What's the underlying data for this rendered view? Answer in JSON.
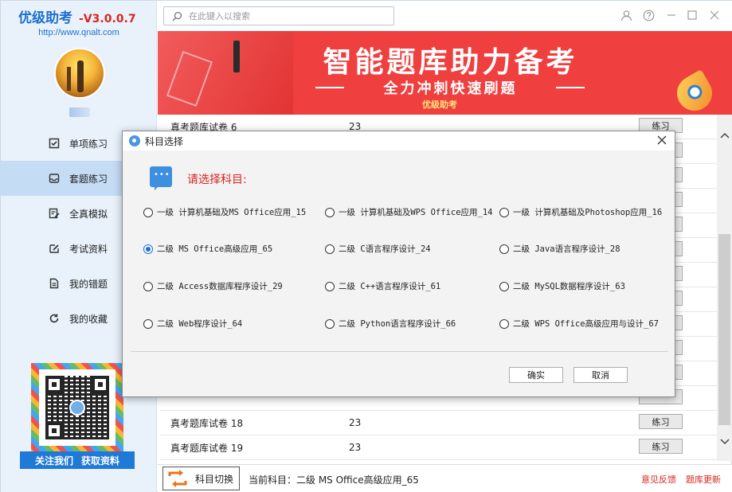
{
  "app": {
    "name": "优级助考",
    "version": "-V3.0.0.7",
    "url": "http://www.qnalt.com"
  },
  "sidebar": {
    "items": [
      {
        "label": "单项练习",
        "icon": "checkbox-icon"
      },
      {
        "label": "套题练习",
        "icon": "inbox-icon"
      },
      {
        "label": "全真模拟",
        "icon": "edit-doc-icon"
      },
      {
        "label": "考试资料",
        "icon": "pencil-note-icon"
      },
      {
        "label": "我的错题",
        "icon": "document-icon"
      },
      {
        "label": "我的收藏",
        "icon": "refresh-icon"
      }
    ],
    "active_index": 1,
    "qr_banner": [
      "关注我们",
      "获取资料"
    ]
  },
  "search": {
    "placeholder": "在此键入以搜索"
  },
  "banner": {
    "headline": "智能题库助力备考",
    "sub": "全力冲刺快速刷题",
    "tag": "优级助考"
  },
  "table": {
    "rows": [
      {
        "name": "真考题库试卷 6",
        "count": "23",
        "action": "练习"
      },
      {
        "name": "",
        "count": "",
        "action": ""
      },
      {
        "name": "",
        "count": "",
        "action": ""
      },
      {
        "name": "",
        "count": "",
        "action": ""
      },
      {
        "name": "",
        "count": "",
        "action": ""
      },
      {
        "name": "",
        "count": "",
        "action": ""
      },
      {
        "name": "",
        "count": "",
        "action": ""
      },
      {
        "name": "",
        "count": "",
        "action": ""
      },
      {
        "name": "",
        "count": "",
        "action": ""
      },
      {
        "name": "",
        "count": "",
        "action": ""
      },
      {
        "name": "",
        "count": "",
        "action": ""
      },
      {
        "name": "",
        "count": "",
        "action": ""
      },
      {
        "name": "真考题库试卷 18",
        "count": "23",
        "action": "练习"
      },
      {
        "name": "真考题库试卷 19",
        "count": "23",
        "action": "练习"
      }
    ]
  },
  "footer": {
    "switch_label": "科目切换",
    "current_label": "当前科目：",
    "current_value": "二级 MS Office高级应用_65",
    "feedback": "意见反馈",
    "update": "题库更新"
  },
  "dialog": {
    "title": "科目选择",
    "prompt": "请选择科目:",
    "options": [
      "一级 计算机基础及MS Office应用_15",
      "一级 计算机基础及WPS Office应用_14",
      "一级 计算机基础及Photoshop应用_16",
      "二级 MS Office高级应用_65",
      "二级 C语言程序设计_24",
      "二级 Java语言程序设计_28",
      "二级 Access数据库程序设计_29",
      "二级 C++语言程序设计_61",
      "二级 MySQL数据程序设计_63",
      "二级 Web程序设计_64",
      "二级 Python语言程序设计_66",
      "二级 WPS Office高级应用与设计_67"
    ],
    "selected_index": 3,
    "ok": "确实",
    "cancel": "取消"
  },
  "colors": {
    "brand_blue": "#1e6fd0",
    "accent_red": "#d7261f",
    "banner_red": "#ef3f3f"
  }
}
